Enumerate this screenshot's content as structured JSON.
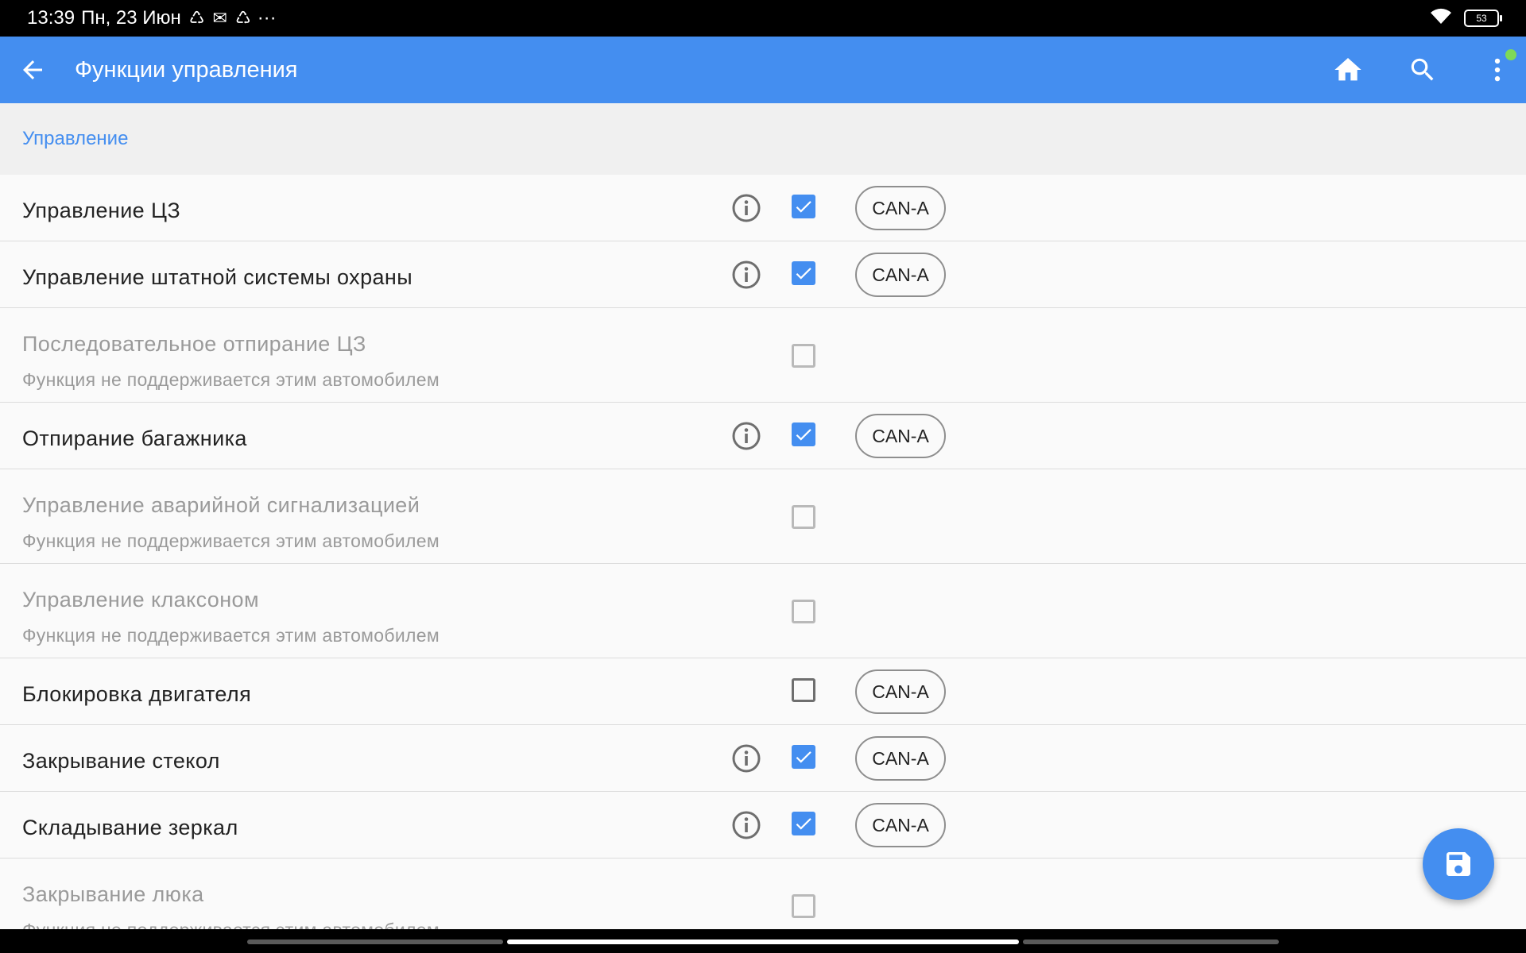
{
  "status_bar": {
    "time": "13:39",
    "date": "Пн, 23 Июн",
    "notification_icons": [
      "sync-icon",
      "mail-icon",
      "sync-icon"
    ],
    "overflow": "···",
    "battery_level": "53"
  },
  "app_bar": {
    "title": "Функции управления",
    "color": "#448ef0",
    "badge_color": "#7ed957"
  },
  "section": {
    "title": "Управление"
  },
  "rows": [
    {
      "label": "Управление ЦЗ",
      "info": true,
      "checked": true,
      "enabled": true,
      "chip": "CAN-A"
    },
    {
      "label": "Управление штатной системы охраны",
      "info": true,
      "checked": true,
      "enabled": true,
      "chip": "CAN-A"
    },
    {
      "label": "Последовательное отпирание ЦЗ",
      "sublabel": "Функция не поддерживается этим автомобилем",
      "checked": false,
      "enabled": false
    },
    {
      "label": "Отпирание багажника",
      "info": true,
      "checked": true,
      "enabled": true,
      "chip": "CAN-A"
    },
    {
      "label": "Управление аварийной сигнализацией",
      "sublabel": "Функция не поддерживается этим автомобилем",
      "checked": false,
      "enabled": false
    },
    {
      "label": "Управление клаксоном",
      "sublabel": "Функция не поддерживается этим автомобилем",
      "checked": false,
      "enabled": false
    },
    {
      "label": "Блокировка двигателя",
      "info": false,
      "checked": false,
      "enabled": true,
      "chip": "CAN-A"
    },
    {
      "label": "Закрывание стекол",
      "info": true,
      "checked": true,
      "enabled": true,
      "chip": "CAN-A"
    },
    {
      "label": "Складывание зеркал",
      "info": true,
      "checked": true,
      "enabled": true,
      "chip": "CAN-A"
    },
    {
      "label": "Закрывание люка",
      "sublabel": "Функция не поддерживается этим автомобилем",
      "checked": false,
      "enabled": false
    }
  ],
  "fab": {
    "icon": "save-icon"
  }
}
